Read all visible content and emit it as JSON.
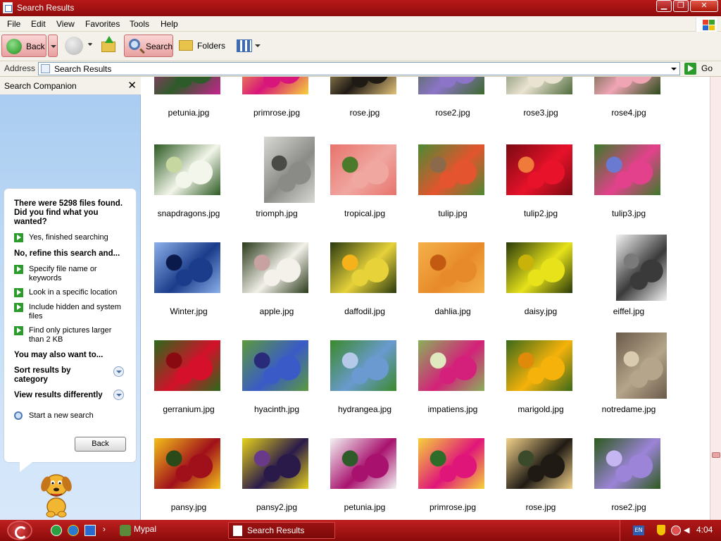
{
  "window": {
    "title": "Search Results",
    "controls": {
      "minimize": "▁",
      "maximize": "❐",
      "close": "✕"
    }
  },
  "menu": [
    "File",
    "Edit",
    "View",
    "Favorites",
    "Tools",
    "Help"
  ],
  "toolbar": {
    "back_label": "Back",
    "search_label": "Search",
    "folders_label": "Folders"
  },
  "address": {
    "label": "Address",
    "value": "Search Results",
    "go_label": "Go"
  },
  "companion": {
    "title": "Search Companion",
    "close": "✕",
    "found_text": "There were 5298 files found. Did you find what you wanted?",
    "yes_link": "Yes, finished searching",
    "refine_head": "No, refine this search and...",
    "refine_links": [
      "Specify file name or keywords",
      "Look in a specific location",
      "Include hidden and system files",
      "Find only pictures larger than 2 KB"
    ],
    "also_head": "You may also want to...",
    "sort_label": "Sort results by category",
    "view_label": "View results differently",
    "new_search": "Start a new search",
    "back_button": "Back"
  },
  "files": [
    {
      "name": "petunia.jpg",
      "colors": [
        "#2e5b2a",
        "#c8238e",
        "#f3f3f3"
      ]
    },
    {
      "name": "primrose.jpg",
      "colors": [
        "#d8157a",
        "#f5d23a",
        "#2e6c2a"
      ]
    },
    {
      "name": "rose.jpg",
      "colors": [
        "#1f1a14",
        "#e2c27a",
        "#3a4a2a"
      ]
    },
    {
      "name": "rose2.jpg",
      "colors": [
        "#8c74c8",
        "#3c6a2c",
        "#b5a5e0"
      ]
    },
    {
      "name": "rose3.jpg",
      "colors": [
        "#eae3d2",
        "#4f6b3c",
        "#c9b99a"
      ]
    },
    {
      "name": "rose4.jpg",
      "colors": [
        "#f0a5b5",
        "#2a4a1a",
        "#d35a7a"
      ]
    },
    {
      "name": "snapdragons.jpg",
      "colors": [
        "#f3f6ea",
        "#2c5a22",
        "#c6d7a0"
      ]
    },
    {
      "name": "triomph.jpg",
      "colors": [
        "#8a8a86",
        "#d8d8d4",
        "#4a4a46"
      ]
    },
    {
      "name": "tropical.jpg",
      "colors": [
        "#f0a7a0",
        "#e7736c",
        "#4a7a2a"
      ]
    },
    {
      "name": "tulip.jpg",
      "colors": [
        "#e4542e",
        "#4c8a34",
        "#8a6a4a"
      ]
    },
    {
      "name": "tulip2.jpg",
      "colors": [
        "#e8122a",
        "#7a0a12",
        "#f07a3a"
      ]
    },
    {
      "name": "tulip3.jpg",
      "colors": [
        "#e4418c",
        "#3b7a2a",
        "#6a7ad0"
      ]
    },
    {
      "name": "Winter.jpg",
      "colors": [
        "#1a3c8a",
        "#8cb0ea",
        "#0a1a4a"
      ]
    },
    {
      "name": "apple.jpg",
      "colors": [
        "#f3f1ea",
        "#2a3a1a",
        "#c7a2a0"
      ]
    },
    {
      "name": "daffodil.jpg",
      "colors": [
        "#e7d23a",
        "#2a3a10",
        "#f5b21a"
      ]
    },
    {
      "name": "dahlia.jpg",
      "colors": [
        "#e78a2a",
        "#f5b24a",
        "#c25a12"
      ]
    },
    {
      "name": "daisy.jpg",
      "colors": [
        "#e7e21a",
        "#2a3a0a",
        "#c9b20a"
      ]
    },
    {
      "name": "eiffel.jpg",
      "colors": [
        "#3a3a3a",
        "#f3f3f3",
        "#7a7a7a"
      ]
    },
    {
      "name": "gerranium.jpg",
      "colors": [
        "#d4102a",
        "#2a6a1a",
        "#8a0a12"
      ]
    },
    {
      "name": "hyacinth.jpg",
      "colors": [
        "#3a5ac8",
        "#5c9a3c",
        "#2a2a7a"
      ]
    },
    {
      "name": "hydrangea.jpg",
      "colors": [
        "#6a9ad0",
        "#3a8a2a",
        "#b5cae8"
      ]
    },
    {
      "name": "impatiens.jpg",
      "colors": [
        "#d4207a",
        "#8ab05a",
        "#e0e8c0"
      ]
    },
    {
      "name": "marigold.jpg",
      "colors": [
        "#f5b20a",
        "#3a6a1a",
        "#e08a0a"
      ]
    },
    {
      "name": "notredame.jpg",
      "colors": [
        "#b5a58a",
        "#6a5a4a",
        "#d8cbb0"
      ]
    },
    {
      "name": "pansy.jpg",
      "colors": [
        "#a0101a",
        "#f3c01a",
        "#2a4a1a"
      ]
    },
    {
      "name": "pansy2.jpg",
      "colors": [
        "#2a1a4a",
        "#e7d21a",
        "#6a3a8a"
      ]
    },
    {
      "name": "petunia.jpg",
      "colors": [
        "#a8126e",
        "#f3f3f3",
        "#2e5b2a"
      ]
    },
    {
      "name": "primrose.jpg",
      "colors": [
        "#e0157a",
        "#f5d23a",
        "#2e6c2a"
      ]
    },
    {
      "name": "rose.jpg",
      "colors": [
        "#1f1a14",
        "#f3d28a",
        "#3a4a2a"
      ]
    },
    {
      "name": "rose2.jpg",
      "colors": [
        "#9c84d8",
        "#2c5a1c",
        "#c5b5f0"
      ]
    }
  ],
  "taskbar": {
    "quick_launch_more": "›",
    "mypal_label": "Mypal",
    "task_label": "Search Results",
    "lang": "EN",
    "clock": "4:04"
  }
}
